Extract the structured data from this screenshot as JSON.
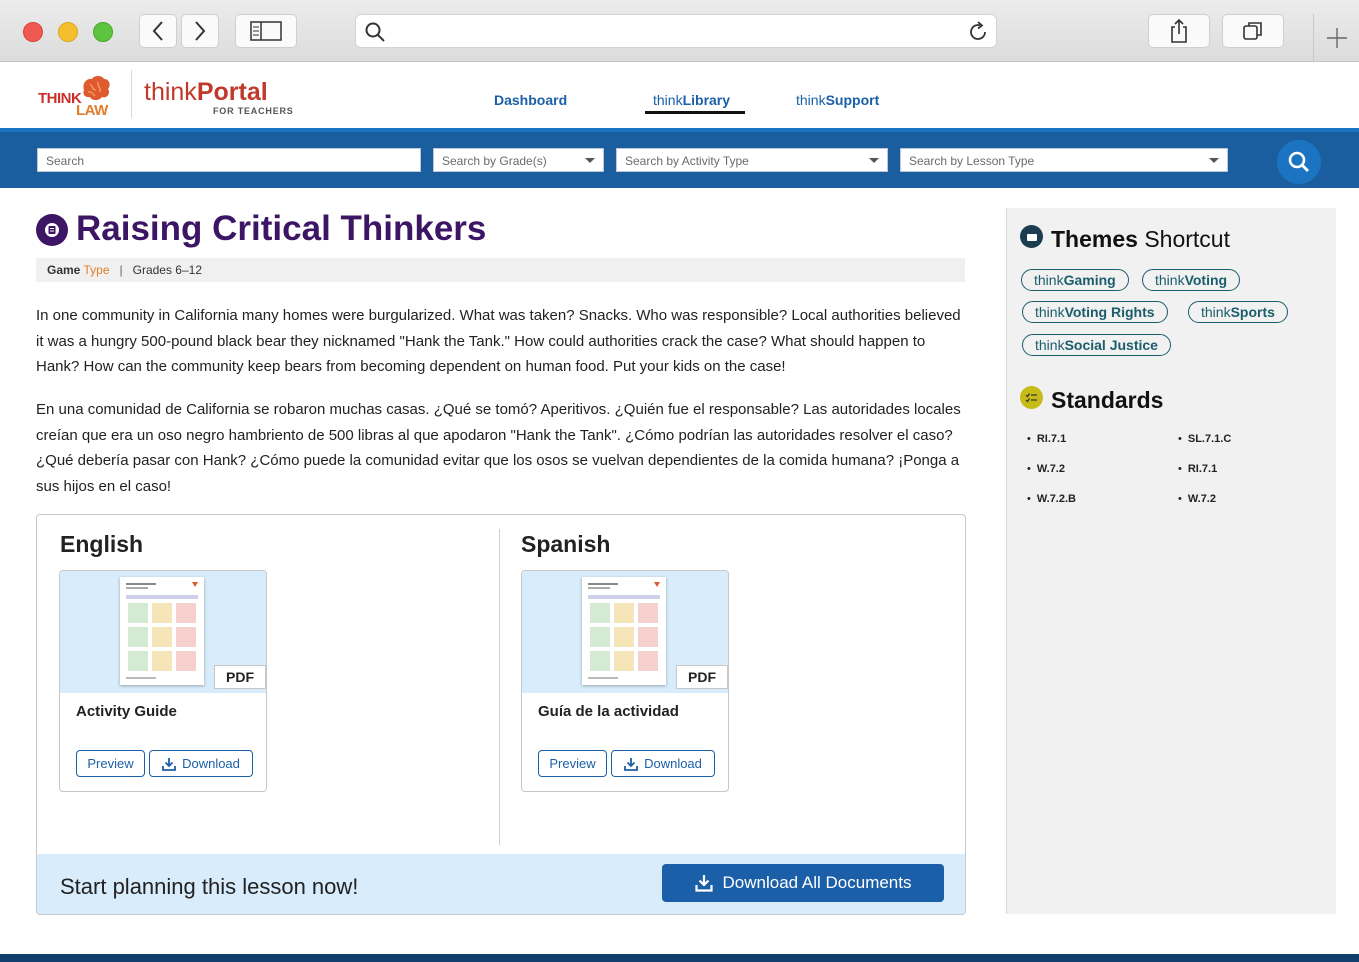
{
  "header": {
    "logo_think": "THINK",
    "logo_law": "LAW",
    "portal_prefix": "think",
    "portal_main": "Portal",
    "portal_sub": "FOR TEACHERS",
    "nav": {
      "dashboard": "Dashboard",
      "library_prefix": "think",
      "library_main": "Library",
      "support_prefix": "think",
      "support_main": "Support"
    }
  },
  "search": {
    "keyword_placeholder": "Search",
    "grade_placeholder": "Search by Grade(s)",
    "activity_placeholder": "Search by Activity Type",
    "lesson_placeholder": "Search by Lesson Type"
  },
  "lesson": {
    "title": "Raising Critical Thinkers",
    "meta_game": "Game",
    "meta_type": "Type",
    "meta_sep": "|",
    "meta_grades": "Grades 6–12",
    "description_en": "In one community in California many homes were burgularized. What was taken? Snacks. Who was responsible? Local authorities believed it was a hungry 500-pound black bear they nicknamed \"Hank the Tank.\" How could authorities crack the case? What should happen to Hank? How can the community keep bears from becoming dependent on human food. Put your kids on the case!",
    "description_es": "En una comunidad de California se robaron muchas casas. ¿Qué se tomó? Aperitivos. ¿Quién fue el responsable? Las autoridades locales creían que era un oso negro hambriento de 500 libras al que apodaron \"Hank the Tank\". ¿Cómo podrían las autoridades resolver el caso? ¿Qué debería pasar con Hank? ¿Cómo puede la comunidad evitar que los osos se vuelvan dependientes de la comida humana? ¡Ponga a sus hijos en el caso!"
  },
  "documents": {
    "english": {
      "heading": "English",
      "file_type": "PDF",
      "name": "Activity Guide",
      "preview_label": "Preview",
      "download_label": "Download"
    },
    "spanish": {
      "heading": "Spanish",
      "file_type": "PDF",
      "name": "Guía de la actividad",
      "preview_label": "Preview",
      "download_label": "Download"
    },
    "cta_text": "Start planning this lesson now!",
    "download_all_label": "Download All Documents"
  },
  "sidebar": {
    "themes_title_bold": "Themes",
    "themes_title_rest": "Shortcut",
    "themes": [
      {
        "prefix": "think",
        "main": "Gaming"
      },
      {
        "prefix": "think",
        "main": "Voting"
      },
      {
        "prefix": "think",
        "main": "Voting Rights"
      },
      {
        "prefix": "think",
        "main": "Sports"
      },
      {
        "prefix": "think",
        "main": "Social Justice"
      }
    ],
    "standards_title": "Standards",
    "standards": [
      "RI.7.1",
      "SL.7.1.C",
      "W.7.2",
      "RI.7.1",
      "W.7.2.B",
      "W.7.2"
    ]
  },
  "colors": {
    "brand_purple": "#3d1565",
    "brand_blue": "#1b5fa8",
    "search_band": "#1a5e9f",
    "accent_orange": "#e27d2b",
    "theme_teal": "#1b5e6b"
  }
}
